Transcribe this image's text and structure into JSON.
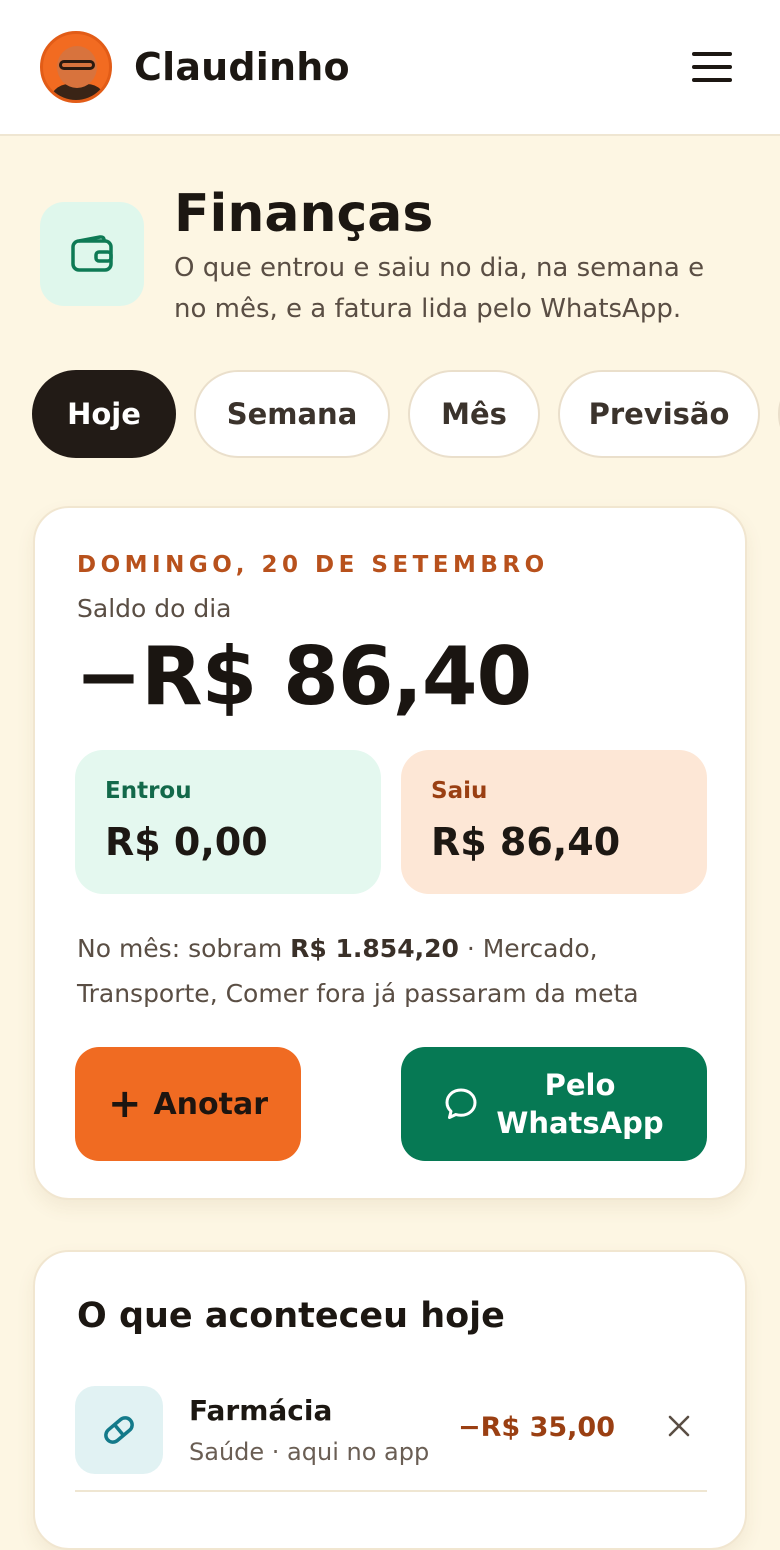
{
  "app": {
    "name": "Claudinho"
  },
  "header": {
    "title": "Finanças",
    "subtitle": "O que entrou e saiu no dia, na semana e no mês, e a fatura lida pelo WhatsApp."
  },
  "tabs": [
    {
      "label": "Hoje",
      "active": true
    },
    {
      "label": "Semana"
    },
    {
      "label": "Mês"
    },
    {
      "label": "Previsão"
    }
  ],
  "today": {
    "date_label": "DOMINGO, 20 DE SETEMBRO",
    "saldo_label": "Saldo do dia",
    "saldo_value": "−R$ 86,40",
    "in_label": "Entrou",
    "in_value": "R$ 0,00",
    "out_label": "Saiu",
    "out_value": "R$ 86,40",
    "summary_prefix": "No mês: sobram ",
    "summary_amount": "R$ 1.854,20",
    "summary_suffix": " · Mercado, Transporte, Comer fora já passaram da meta",
    "add_label": "Anotar",
    "whatsapp_label": "Pelo WhatsApp"
  },
  "history": {
    "title": "O que aconteceu hoje",
    "items": [
      {
        "name": "Farmácia",
        "meta": "Saúde · aqui no app",
        "amount": "−R$ 35,00",
        "icon": "pill-icon"
      }
    ]
  },
  "colors": {
    "accent_orange": "#f06b22",
    "whatsapp_green": "#067954",
    "background": "#fdf6e3",
    "dark": "#221b16"
  }
}
